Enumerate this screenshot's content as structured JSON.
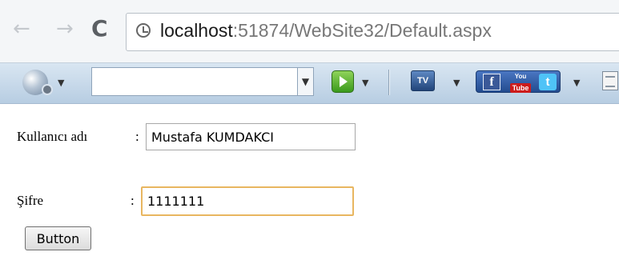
{
  "browser": {
    "url_host": "localhost",
    "url_path": ":51874/WebSite32/Default.aspx",
    "icons": {
      "back": "back-arrow-icon",
      "forward": "forward-arrow-icon",
      "reload": "reload-icon",
      "page": "page-info-icon"
    }
  },
  "toolbar": {
    "search_value": "",
    "icons": [
      "globe-settings-icon",
      "green-play-icon",
      "tv-icon",
      "facebook-youtube-twitter-icon",
      "document-icon"
    ],
    "social": {
      "facebook": "f",
      "youtube_top": "You",
      "youtube_bottom": "Tube",
      "twitter": "t"
    },
    "tv_label": "TV"
  },
  "form": {
    "username_label": "Kullanıcı adı",
    "username_colon": ":",
    "username_value": "Mustafa KUMDAKCI",
    "password_label": "Şifre",
    "password_colon": ":",
    "password_value": "1111111",
    "button_label": "Button"
  },
  "colors": {
    "toolbar_top": "#d9e6f2",
    "toolbar_bottom": "#b7cde2",
    "focus_border": "#e8b660"
  }
}
